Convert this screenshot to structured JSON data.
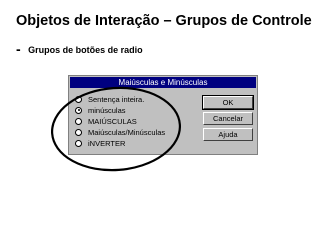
{
  "slide": {
    "title": "Objetos de Interação – Grupos de Controle",
    "bullet": "-",
    "subtitle": "Grupos de botões de radio"
  },
  "dialog": {
    "title": "Maiúsculas e Minúsculas",
    "options": [
      {
        "label": "Sentença inteira.",
        "checked": false
      },
      {
        "label": "minúsculas",
        "checked": true
      },
      {
        "label": "MAIÚSCULAS",
        "checked": false
      },
      {
        "label": "Maiúsculas/Minúsculas",
        "checked": false
      },
      {
        "label": "iNVERTER",
        "checked": false
      }
    ],
    "buttons": {
      "ok": "OK",
      "cancel": "Cancelar",
      "help": "Ajuda"
    }
  }
}
